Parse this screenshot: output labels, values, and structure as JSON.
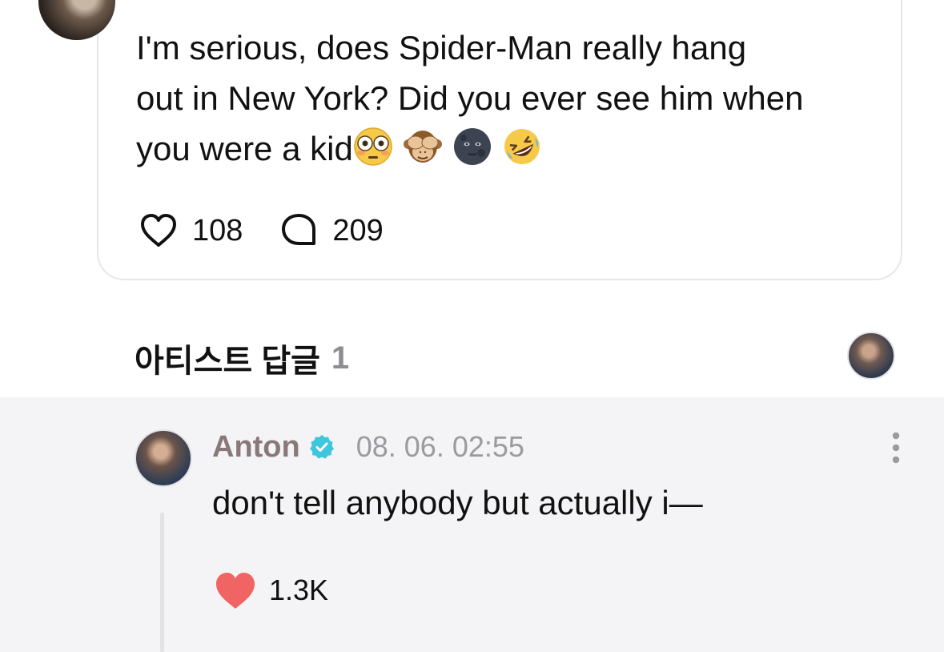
{
  "post": {
    "text_line1": "I'm serious, does Spider-Man really hang",
    "text_line2": "out in New York? Did you ever see him when",
    "text_line3": "you were a kid",
    "emojis": [
      "flushed-face",
      "see-no-evil-monkey",
      "new-moon-face",
      "rolling-on-floor-laughing"
    ],
    "like_count": "108",
    "comment_count": "209"
  },
  "artist_replies": {
    "title": "아티스트 답글",
    "count": "1"
  },
  "reply": {
    "author": "Anton",
    "timestamp": "08. 06. 02:55",
    "text": "don't tell anybody but actually i—",
    "like_count": "1.3K"
  },
  "colors": {
    "verified": "#3ec6dd",
    "liked_heart": "#f06464",
    "author_name": "#8a7878",
    "reply_background": "#f4f4f6"
  }
}
